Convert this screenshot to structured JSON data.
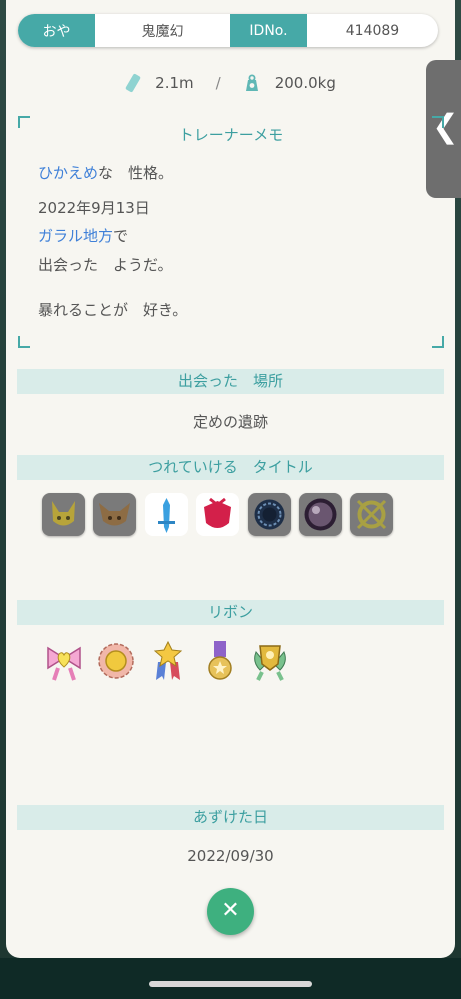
{
  "owner": {
    "ot_label": "おや",
    "ot_name": "鬼魔幻",
    "id_label": "IDNo.",
    "id_value": "414089"
  },
  "stats": {
    "height_icon": "ruler-icon",
    "height": "2.1m",
    "separator": "/",
    "weight_icon": "weight-icon",
    "weight": "200.0kg"
  },
  "side_tab": {
    "icon": "chevron-left-icon",
    "glyph": "❮"
  },
  "trainer_memo": {
    "title": "トレーナーメモ",
    "nature": "ひかえめ",
    "nature_suffix": "な　性格。",
    "date": "2022年9月13日",
    "location": "ガラル地方",
    "location_suffix": "で",
    "met_line": "出会った　ようだ。",
    "characteristic": "暴れることが　好き。"
  },
  "met_location": {
    "header": "出会った　場所",
    "value": "定めの遺跡"
  },
  "titles": {
    "header": "つれていける　タイトル",
    "items": [
      "pikachu-mark-icon",
      "eevee-mark-icon",
      "sword-mark-icon",
      "shield-mark-icon",
      "dark-ring-icon",
      "purple-orb-icon",
      "crossed-ring-icon"
    ]
  },
  "ribbons": {
    "header": "リボン",
    "items": [
      "heart-bow-ribbon-icon",
      "flower-ribbon-icon",
      "star-medal-ribbon-icon",
      "purple-medal-ribbon-icon",
      "winged-crest-ribbon-icon"
    ]
  },
  "deposit": {
    "header": "あずけた日",
    "date": "2022/09/30"
  },
  "close_button": {
    "icon": "close-icon",
    "glyph": "✕"
  },
  "colors": {
    "accent_teal": "#46a9a7",
    "header_bg": "#d9ece9",
    "blue_text": "#3f80d8",
    "close_green": "#3eb07f",
    "panel_bg": "#f7f6f1"
  }
}
